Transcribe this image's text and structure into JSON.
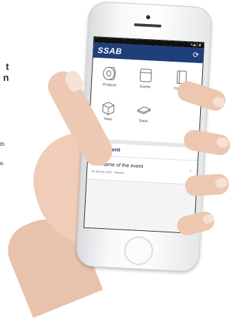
{
  "page_text": {
    "fragment_1": "t",
    "fragment_2": "n",
    "fragment_3": "th",
    "fragment_4": "e."
  },
  "app": {
    "brand": "SSAB",
    "refresh_icon": "refresh-icon",
    "tiles": [
      {
        "label": "Products",
        "icon": "products-coil-icon"
      },
      {
        "label": "Events",
        "icon": "events-calendar-icon"
      },
      {
        "label": "Contacts",
        "icon": "contacts-book-icon"
      },
      {
        "label": "Tools",
        "icon": "tools-box-icon"
      },
      {
        "label": "Stock",
        "icon": "stock-plate-icon"
      }
    ],
    "next_event_heading": "Next event",
    "event": {
      "name": "The name of the event",
      "date_location": "24 January 2013 - Sweden"
    }
  },
  "colors": {
    "brand_blue": "#1e3f7a",
    "skin": "#efcdb8"
  }
}
